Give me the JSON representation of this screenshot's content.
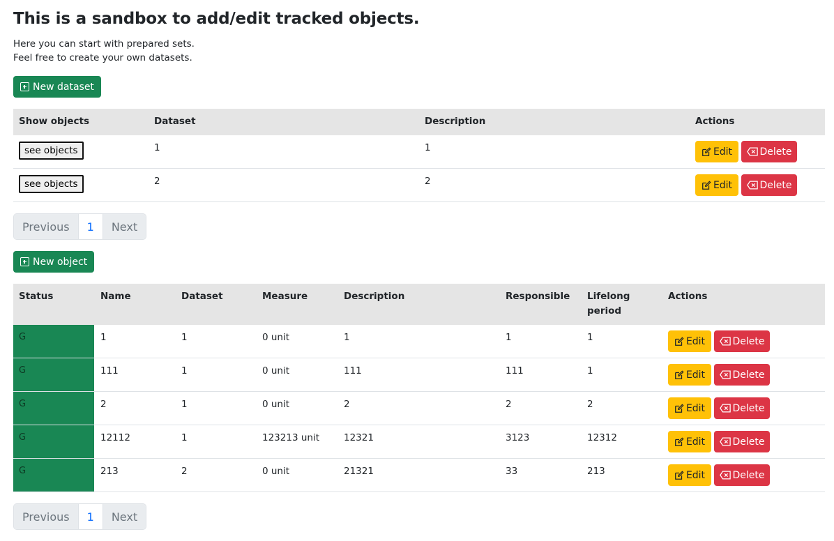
{
  "title": "This is a sandbox to add/edit tracked objects.",
  "intro": [
    "Here you can start with prepared sets.",
    "Feel free to create your own datasets."
  ],
  "new_dataset_label": "New dataset",
  "new_object_label": "New object",
  "datasets_table": {
    "headers": {
      "show": "Show objects",
      "dataset": "Dataset",
      "description": "Description",
      "actions": "Actions"
    },
    "see_label": "see objects",
    "rows": [
      {
        "dataset": "1",
        "description": "1"
      },
      {
        "dataset": "2",
        "description": "2"
      }
    ]
  },
  "objects_table": {
    "headers": {
      "status": "Status",
      "name": "Name",
      "dataset": "Dataset",
      "measure": "Measure",
      "description": "Description",
      "responsible": "Responsible",
      "lifelong_1": "Lifelong",
      "lifelong_2": "period",
      "actions": "Actions"
    },
    "rows": [
      {
        "status": "G",
        "name": "1",
        "dataset": "1",
        "measure": "0 unit",
        "description": "1",
        "responsible": "1",
        "lifelong": "1"
      },
      {
        "status": "G",
        "name": "111",
        "dataset": "1",
        "measure": "0 unit",
        "description": "111",
        "responsible": "111",
        "lifelong": "1"
      },
      {
        "status": "G",
        "name": "2",
        "dataset": "1",
        "measure": "0 unit",
        "description": "2",
        "responsible": "2",
        "lifelong": "2"
      },
      {
        "status": "G",
        "name": "12112",
        "dataset": "1",
        "measure": "123213 unit",
        "description": "12321",
        "responsible": "3123",
        "lifelong": "12312"
      },
      {
        "status": "G",
        "name": "213",
        "dataset": "2",
        "measure": "0 unit",
        "description": "21321",
        "responsible": "33",
        "lifelong": "213"
      }
    ]
  },
  "actions": {
    "edit": "Edit",
    "delete": "Delete"
  },
  "pagination": {
    "previous": "Previous",
    "page": "1",
    "next": "Next"
  },
  "colors": {
    "success": "#198754",
    "warning": "#ffc107",
    "danger": "#dc3545",
    "link": "#0d6efd"
  },
  "icons": {
    "new": "plus-square-icon",
    "edit": "pencil-square-icon",
    "delete": "backspace-icon"
  }
}
